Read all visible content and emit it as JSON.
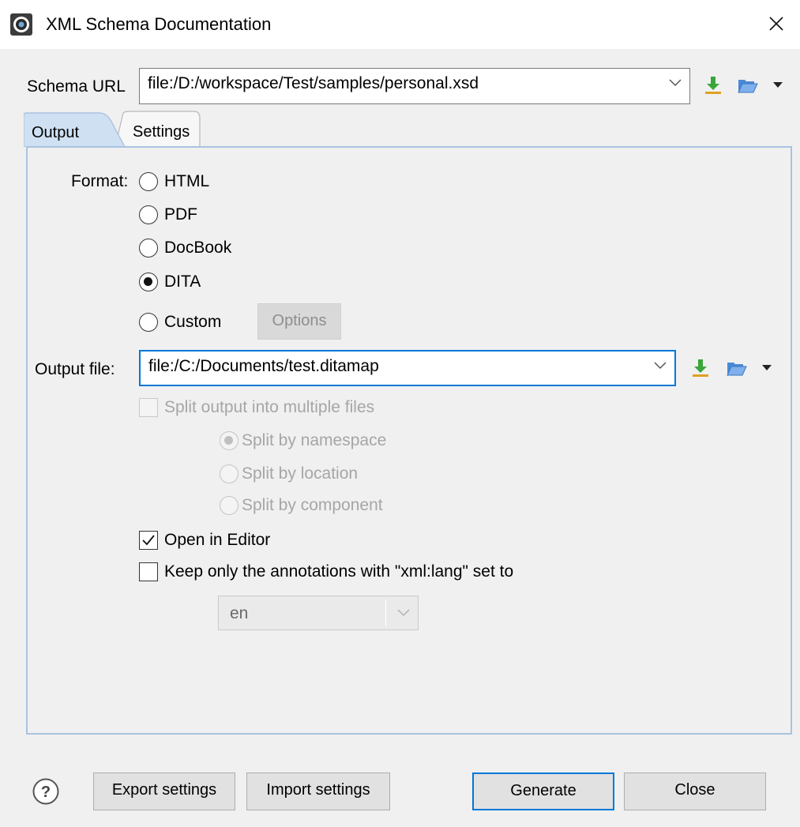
{
  "window": {
    "title": "XML Schema Documentation",
    "icon": "gear-icon",
    "close": "close-icon"
  },
  "schema": {
    "label": "Schema URL",
    "value": "file:/D:/workspace/Test/samples/personal.xsd"
  },
  "tabs": [
    {
      "label": "Output",
      "active": true
    },
    {
      "label": "Settings",
      "active": false
    }
  ],
  "format": {
    "label": "Format:",
    "options": [
      {
        "label": "HTML",
        "checked": false
      },
      {
        "label": "PDF",
        "checked": false
      },
      {
        "label": "DocBook",
        "checked": false
      },
      {
        "label": "DITA",
        "checked": true
      },
      {
        "label": "Custom",
        "checked": false
      }
    ],
    "options_button": "Options"
  },
  "output": {
    "label": "Output file:",
    "value": "file:/C:/Documents/test.ditamap"
  },
  "split": {
    "label": "Split output into multiple files",
    "checked": false,
    "enabled": false,
    "options": [
      {
        "label": "Split by namespace",
        "checked": true
      },
      {
        "label": "Split by location",
        "checked": false
      },
      {
        "label": "Split by component",
        "checked": false
      }
    ]
  },
  "open_in_editor": {
    "label": "Open in Editor",
    "checked": true
  },
  "keep_annotations": {
    "label": "Keep only the annotations with \"xml:lang\" set to",
    "checked": false
  },
  "lang": {
    "value": "en"
  },
  "footer": {
    "help": "help-icon",
    "export": "Export settings",
    "import": "Import settings",
    "generate": "Generate",
    "close": "Close"
  },
  "colors": {
    "accent": "#0078d7",
    "panel_border": "#a9c3e0",
    "tab_active": "#cfe0f3",
    "download_green": "#3aa63a",
    "folder_blue": "#4a8ad8"
  }
}
